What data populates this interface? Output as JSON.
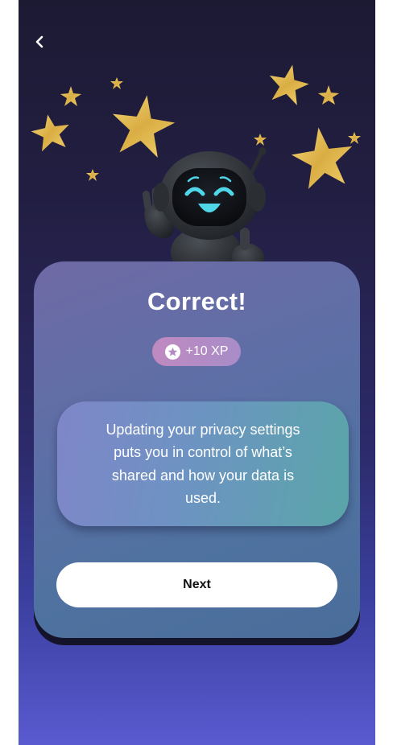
{
  "header": {
    "back_icon": "chevron-left-icon"
  },
  "result": {
    "title": "Correct!",
    "xp_icon": "star-circle-icon",
    "xp_label": "+10 XP",
    "message": "Updating your privacy settings puts you in control of what’s shared and how your data is used."
  },
  "actions": {
    "next_label": "Next"
  },
  "colors": {
    "background_top": "#1c1a33",
    "background_bottom": "#5a5ad0",
    "card": "#5d6fa6",
    "badge": "#b98bc4",
    "message_box_left": "#7f86c9",
    "message_box_right": "#5aa6a9",
    "robot_face_accent": "#4fd6e8",
    "star_gold": "#e9c45a"
  }
}
